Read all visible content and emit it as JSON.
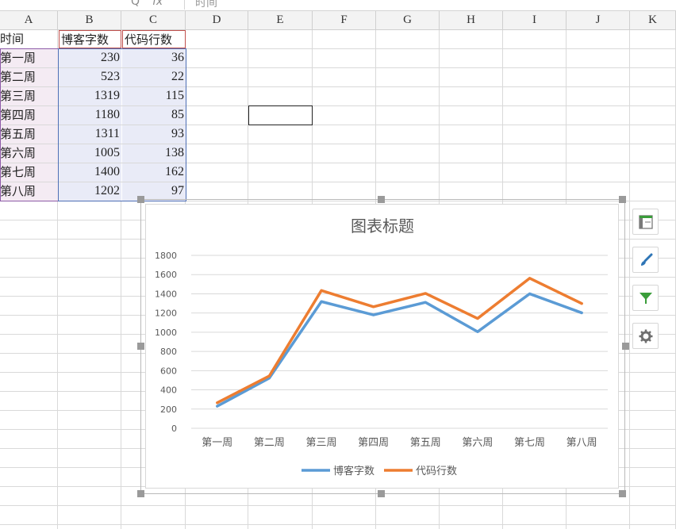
{
  "formula_bar": {
    "zoom_glyph": "Q",
    "fx_label": "fx",
    "content": "时间"
  },
  "columns": [
    "A",
    "B",
    "C",
    "D",
    "E",
    "F",
    "G",
    "H",
    "I",
    "J",
    "K"
  ],
  "table": {
    "headers": [
      "时间",
      "博客字数",
      "代码行数"
    ],
    "rows": [
      {
        "week": "第一周",
        "blog": "230",
        "code": "36"
      },
      {
        "week": "第二周",
        "blog": "523",
        "code": "22"
      },
      {
        "week": "第三周",
        "blog": "1319",
        "code": "115"
      },
      {
        "week": "第四周",
        "blog": "1180",
        "code": "85"
      },
      {
        "week": "第五周",
        "blog": "1311",
        "code": "93"
      },
      {
        "week": "第六周",
        "blog": "1005",
        "code": "138"
      },
      {
        "week": "第七周",
        "blog": "1400",
        "code": "162"
      },
      {
        "week": "第八周",
        "blog": "1202",
        "code": "97"
      }
    ]
  },
  "chart_data": {
    "type": "line",
    "stacked": true,
    "title": "图表标题",
    "categories": [
      "第一周",
      "第二周",
      "第三周",
      "第四周",
      "第五周",
      "第六周",
      "第七周",
      "第八周"
    ],
    "series": [
      {
        "name": "博客字数",
        "values": [
          230,
          523,
          1319,
          1180,
          1311,
          1005,
          1400,
          1202
        ],
        "color": "#5b9bd5"
      },
      {
        "name": "代码行数",
        "values": [
          36,
          22,
          115,
          85,
          93,
          138,
          162,
          97
        ],
        "color": "#ed7d31"
      }
    ],
    "yticks": [
      "0",
      "200",
      "400",
      "600",
      "800",
      "1000",
      "1200",
      "1400",
      "1600",
      "1800"
    ],
    "ylim": [
      0,
      1800
    ],
    "grid": true,
    "legend": "bottom"
  },
  "side_tools": [
    {
      "icon": "chart-elements-icon"
    },
    {
      "icon": "chart-style-brush-icon"
    },
    {
      "icon": "chart-filter-icon"
    },
    {
      "icon": "chart-settings-gear-icon"
    }
  ]
}
